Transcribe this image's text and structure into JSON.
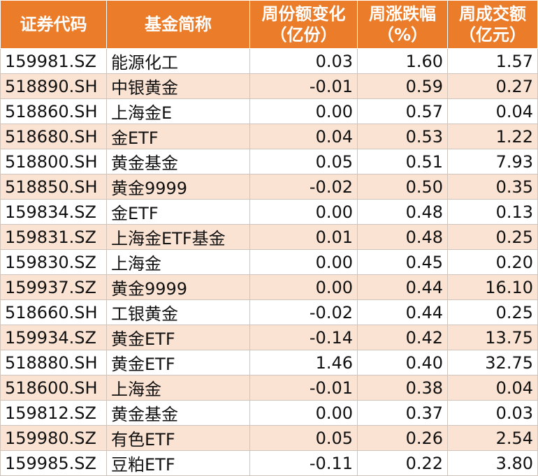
{
  "header": {
    "code": "证券代码",
    "name": "基金简称",
    "share_change_1": "周份额变化",
    "share_change_2": "（亿份）",
    "pct_change_1": "周涨跌幅",
    "pct_change_2": "（%）",
    "turnover_1": "周成交额",
    "turnover_2": "（亿元）"
  },
  "rows": [
    {
      "code": "159981.SZ",
      "name": "能源化工",
      "share_change": "0.03",
      "pct_change": "1.60",
      "turnover": "1.57"
    },
    {
      "code": "518890.SH",
      "name": "中银黄金",
      "share_change": "-0.01",
      "pct_change": "0.59",
      "turnover": "0.27"
    },
    {
      "code": "518860.SH",
      "name": "上海金E",
      "share_change": "0.00",
      "pct_change": "0.57",
      "turnover": "0.04"
    },
    {
      "code": "518680.SH",
      "name": "金ETF",
      "share_change": "0.04",
      "pct_change": "0.53",
      "turnover": "1.22"
    },
    {
      "code": "518800.SH",
      "name": "黄金基金",
      "share_change": "0.05",
      "pct_change": "0.51",
      "turnover": "7.93"
    },
    {
      "code": "518850.SH",
      "name": "黄金9999",
      "share_change": "-0.02",
      "pct_change": "0.50",
      "turnover": "0.35"
    },
    {
      "code": "159834.SZ",
      "name": "金ETF",
      "share_change": "0.00",
      "pct_change": "0.48",
      "turnover": "0.13"
    },
    {
      "code": "159831.SZ",
      "name": "上海金ETF基金",
      "share_change": "0.01",
      "pct_change": "0.48",
      "turnover": "0.25"
    },
    {
      "code": "159830.SZ",
      "name": "上海金",
      "share_change": "0.00",
      "pct_change": "0.45",
      "turnover": "0.20"
    },
    {
      "code": "159937.SZ",
      "name": "黄金9999",
      "share_change": "0.00",
      "pct_change": "0.44",
      "turnover": "16.10"
    },
    {
      "code": "518660.SH",
      "name": "工银黄金",
      "share_change": "-0.02",
      "pct_change": "0.44",
      "turnover": "0.25"
    },
    {
      "code": "159934.SZ",
      "name": "黄金ETF",
      "share_change": "-0.14",
      "pct_change": "0.42",
      "turnover": "13.75"
    },
    {
      "code": "518880.SH",
      "name": "黄金ETF",
      "share_change": "1.46",
      "pct_change": "0.40",
      "turnover": "32.75"
    },
    {
      "code": "518600.SH",
      "name": "上海金",
      "share_change": "-0.01",
      "pct_change": "0.38",
      "turnover": "0.04"
    },
    {
      "code": "159812.SZ",
      "name": "黄金基金",
      "share_change": "0.00",
      "pct_change": "0.37",
      "turnover": "0.03"
    },
    {
      "code": "159980.SZ",
      "name": "有色ETF",
      "share_change": "0.05",
      "pct_change": "0.26",
      "turnover": "2.54"
    },
    {
      "code": "159985.SZ",
      "name": "豆粕ETF",
      "share_change": "-0.11",
      "pct_change": "0.22",
      "turnover": "3.80"
    }
  ]
}
